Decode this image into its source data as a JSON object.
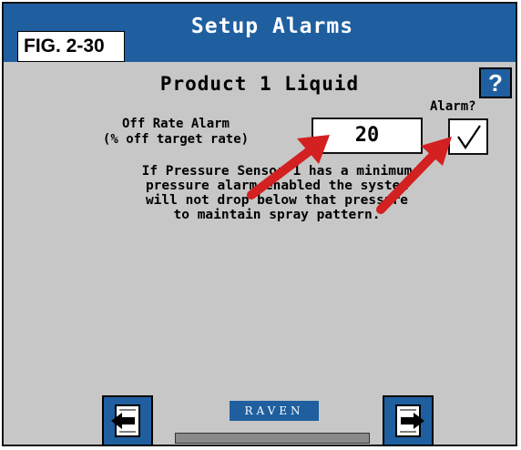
{
  "window": {
    "title": "Setup Alarms",
    "figure_label": "FIG. 2-30"
  },
  "page": {
    "subtitle": "Product 1 Liquid",
    "help_label": "?",
    "alarm_header": "Alarm?",
    "off_rate_label_line1": "Off Rate Alarm",
    "off_rate_label_line2": "(% off target rate)",
    "off_rate_value": "20",
    "alarm_checked": true,
    "info_lines": [
      "If Pressure Sensor 1 has a minimum",
      "pressure alarm enabled the system",
      "will not drop below that pressure",
      "to maintain spray pattern."
    ]
  },
  "footer": {
    "brand": "RAVEN"
  },
  "colors": {
    "titlebar": "#1f5fa0",
    "background": "#c7c7c7",
    "arrow": "#d32020"
  },
  "icons": {
    "prev": "page-back-icon",
    "next": "page-forward-icon",
    "check": "checkmark-icon"
  }
}
